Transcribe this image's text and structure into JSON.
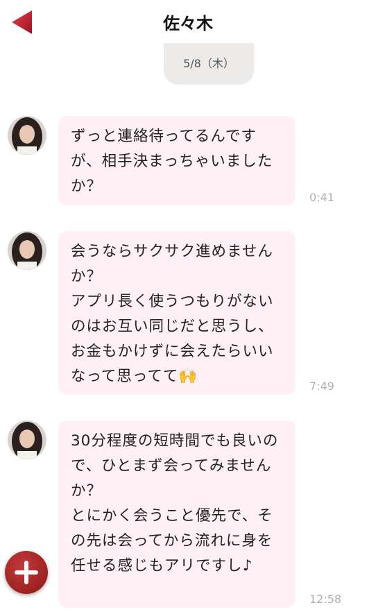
{
  "header": {
    "title": "佐々木",
    "back_icon": "back-arrow-icon",
    "accent_color": "#c01e2e"
  },
  "date_separator": "5/8（木）",
  "messages": [
    {
      "sender": "佐々木",
      "text": "ずっと連絡待ってるんですが、相手決まっちゃいましたか？",
      "time": "0:41"
    },
    {
      "sender": "佐々木",
      "text": "会うならサクサク進めませんか？\nアプリ長く使うつもりがないのはお互い同じだと思うし、お金もかけずに会えたらいいなって思ってて🙌",
      "time": "7:49"
    },
    {
      "sender": "佐々木",
      "text": "30分程度の短時間でも良いので、ひとまず会ってみませんか？\nとにかく会うこと優先で、その先は会ってから流れに身を任せる感じもアリですし♪",
      "time": "12:58"
    }
  ],
  "fab": {
    "icon": "plus-icon",
    "color": "#a52222"
  }
}
